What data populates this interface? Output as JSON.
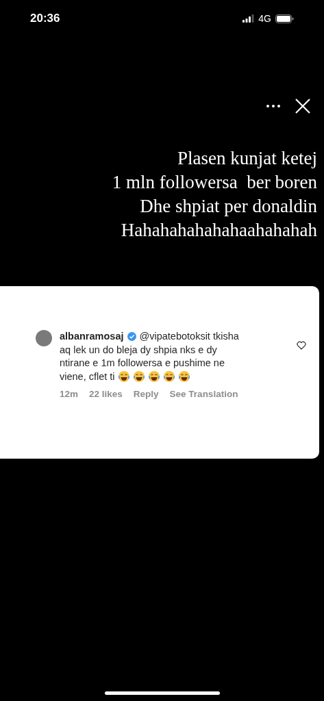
{
  "status_bar": {
    "time": "20:36",
    "network": "4G"
  },
  "caption": {
    "lines": [
      "Plasen kunjat ketej",
      "1 mln followersa  ber boren",
      "Dhe shpiat per donaldin",
      "Hahahahahahahaahahahah"
    ]
  },
  "comment": {
    "username": "albanramosaj",
    "verified": true,
    "text_lines": [
      "@vipatebotoksit tkisha",
      "aq lek un do bleja dy shpia nks e dy",
      "ntirane e 1m followersa e pushime ne",
      "viene, cflet ti"
    ],
    "emoji": [
      {
        "kind": "laughing"
      },
      {
        "kind": "laughing"
      },
      {
        "kind": "laughing"
      },
      {
        "kind": "laughing"
      },
      {
        "kind": "laughing"
      }
    ],
    "liked": false,
    "meta": [
      "12m",
      "22 likes",
      "Reply",
      "See Translation"
    ]
  }
}
